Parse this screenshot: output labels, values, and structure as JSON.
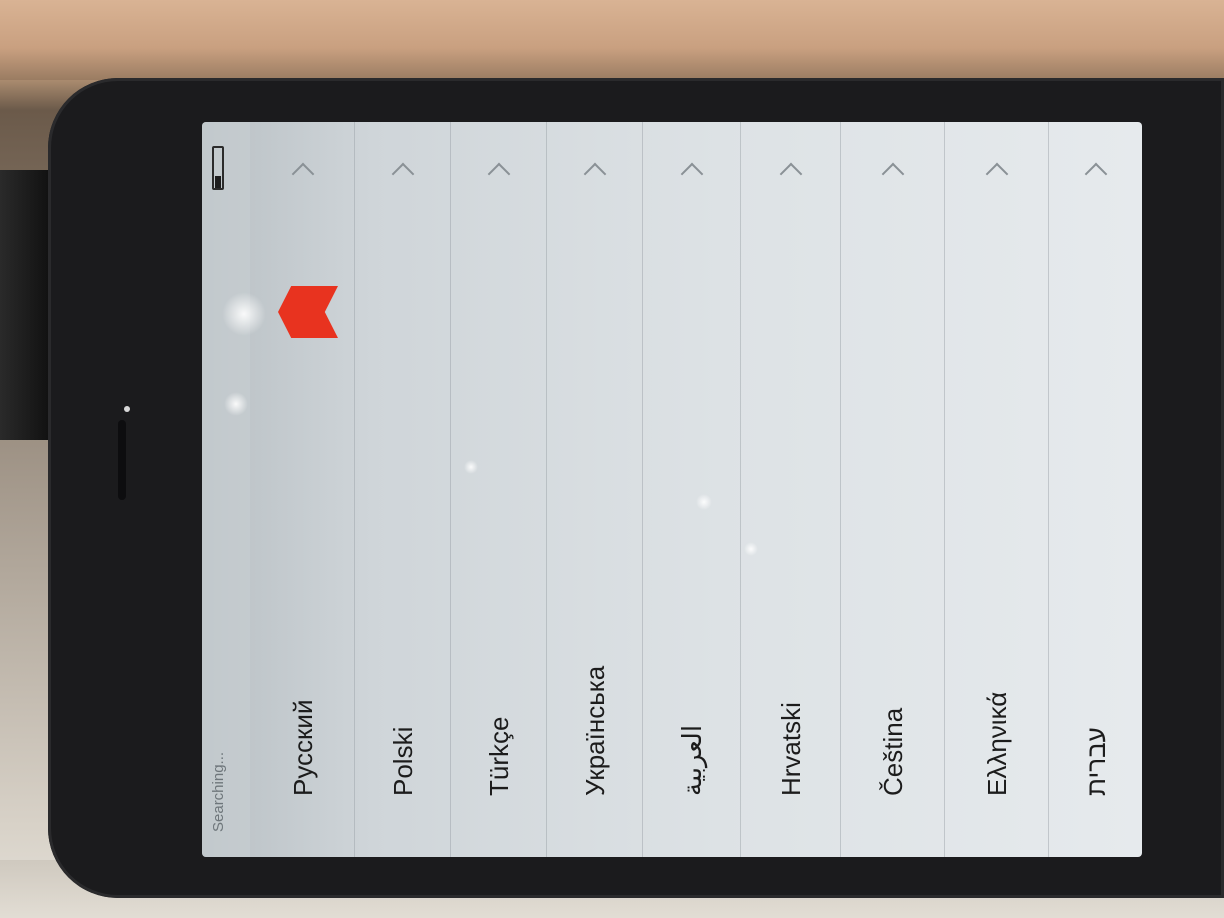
{
  "status_bar": {
    "status_text": "Searching..."
  },
  "languages": [
    {
      "label": "Русский"
    },
    {
      "label": "Polski"
    },
    {
      "label": "Türkçe"
    },
    {
      "label": "Українська"
    },
    {
      "label": "العربية"
    },
    {
      "label": "Hrvatski"
    },
    {
      "label": "Čeština"
    },
    {
      "label": "Ελληνικά"
    },
    {
      "label": "עברית"
    }
  ],
  "colors": {
    "screen_bg": "#dde2e5",
    "text": "#1c1c1c",
    "separator": "#969ea3",
    "marker": "#e8331f"
  },
  "icons": {
    "row_chevron": "chevron-right-icon",
    "battery": "battery-icon",
    "marker": "flag-marker-icon"
  }
}
